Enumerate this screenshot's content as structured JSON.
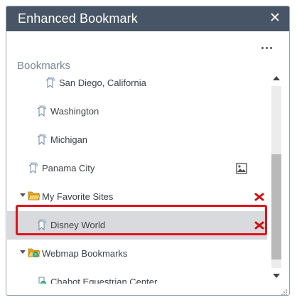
{
  "panel": {
    "title": "Enhanced Bookmark",
    "close_icon": "close-icon",
    "more_icon": "more-options-icon"
  },
  "section": {
    "label": "Bookmarks"
  },
  "bookmarks": {
    "san_diego": {
      "label": "San Diego, California",
      "icon": "bookmark-icon"
    },
    "washington": {
      "label": "Washington",
      "icon": "bookmark-icon"
    },
    "michigan": {
      "label": "Michigan",
      "icon": "bookmark-icon"
    },
    "panama_city": {
      "label": "Panama City",
      "icon": "bookmark-icon",
      "action_icon": "image-icon"
    },
    "favorites": {
      "label": "My Favorite Sites",
      "icon": "folder-icon",
      "expanded": true,
      "action_icon": "delete-icon"
    },
    "disney_world": {
      "label": "Disney World",
      "icon": "bookmark-icon",
      "selected": true,
      "action_icon": "delete-icon"
    },
    "webmap": {
      "label": "Webmap Bookmarks",
      "icon": "webmap-folder-icon",
      "expanded": true
    },
    "chabot": {
      "label": "Chabot Equestrian Center",
      "icon": "webmap-bookmark-icon"
    }
  },
  "colors": {
    "titlebar": "#485566",
    "selected_row": "#d9dadd",
    "selection_outline": "#e0121b",
    "delete_icon": "#cc1111",
    "folder": "#f3c14b"
  }
}
